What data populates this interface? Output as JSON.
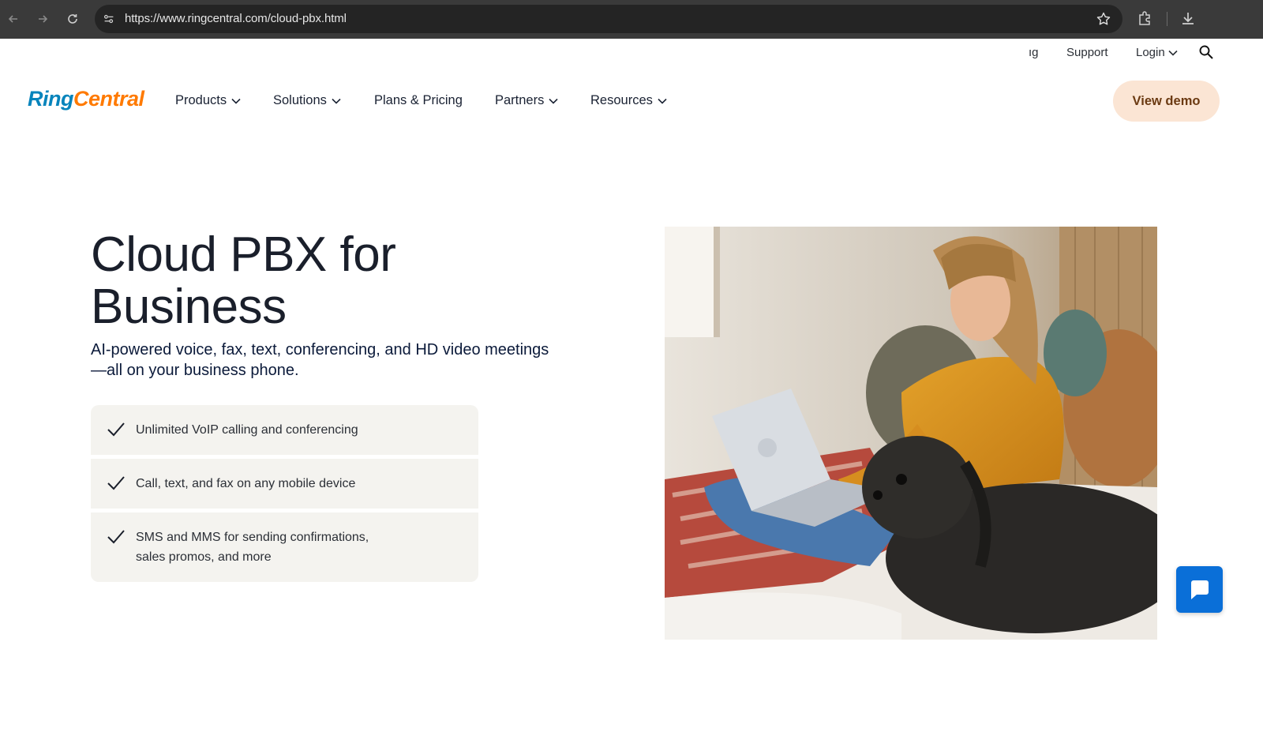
{
  "browser": {
    "url": "https://www.ringcentral.com/cloud-pbx.html"
  },
  "utility_nav": {
    "partial_item": "ıg",
    "support": "Support",
    "login": "Login"
  },
  "logo": {
    "part1": "Ring",
    "part2": "Central"
  },
  "main_nav": {
    "items": [
      "Products",
      "Solutions",
      "Plans & Pricing",
      "Partners",
      "Resources"
    ],
    "cta": "View demo"
  },
  "hero": {
    "title_line1": "Cloud PBX for",
    "title_line2": "Business",
    "subtitle_line1": "AI-powered voice, fax, text, conferencing, and HD video meetings",
    "subtitle_line2": "—all on your business phone.",
    "features": [
      "Unlimited VoIP calling and conferencing",
      "Call, text, and fax on any mobile device",
      "SMS and MMS for sending confirmations,",
      "sales promos, and more"
    ]
  },
  "colors": {
    "brand_blue": "#0684bc",
    "brand_orange": "#ff7a00",
    "cta_bg": "#fbe5d4",
    "chat_blue": "#0a6fd8"
  },
  "icons": [
    "back-icon",
    "forward-icon",
    "reload-icon",
    "site-settings-icon",
    "star-icon",
    "extensions-icon",
    "download-icon",
    "search-icon",
    "chevron-down-icon",
    "check-icon",
    "chat-icon"
  ]
}
